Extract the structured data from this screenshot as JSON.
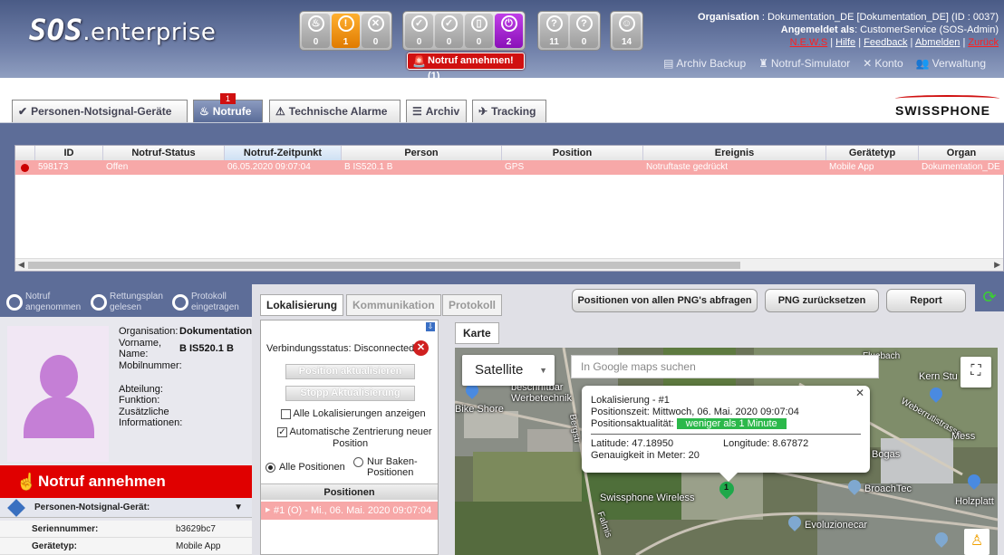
{
  "header": {
    "logo_sos": "SOS",
    "logo_rest": ".enterprise",
    "status_groups": [
      [
        {
          "count": "0",
          "color": "gray",
          "icon": "siren-icon",
          "glyph": "♨"
        },
        {
          "count": "1",
          "color": "orange",
          "icon": "exclamation-icon",
          "glyph": "!"
        },
        {
          "count": "0",
          "color": "gray",
          "icon": "x-circle-icon",
          "glyph": "✕"
        }
      ],
      [
        {
          "count": "0",
          "color": "gray",
          "icon": "check-circle-icon",
          "glyph": "✓"
        },
        {
          "count": "0",
          "color": "gray",
          "icon": "check-slash-icon",
          "glyph": "✓"
        },
        {
          "count": "0",
          "color": "gray",
          "icon": "battery-icon",
          "glyph": "▯"
        },
        {
          "count": "2",
          "color": "purple",
          "icon": "power-icon",
          "glyph": "⏻"
        }
      ],
      [
        {
          "count": "11",
          "color": "gray",
          "icon": "question-circle-icon",
          "glyph": "?"
        },
        {
          "count": "0",
          "color": "gray",
          "icon": "question-slash-icon",
          "glyph": "?"
        }
      ],
      [
        {
          "count": "14",
          "color": "gray",
          "icon": "smiley-icon",
          "glyph": "☺"
        }
      ]
    ],
    "alert_button": "Notruf annehmen! (1)",
    "org_label": "Organisation",
    "org_value": ": Dokumentation_DE [Dokumentation_DE] (ID : 0037)",
    "login_label": "Angemeldet als",
    "login_value": ": CustomerService (SOS-Admin)",
    "links": [
      "N.E.W.S",
      "Hilfe",
      "Feedback",
      "Abmelden",
      "Zurück"
    ],
    "toolbar": [
      "Archiv Backup",
      "Notruf-Simulator",
      "Konto",
      "Verwaltung"
    ]
  },
  "tabs": [
    {
      "label": "Personen-Notsignal-Geräte"
    },
    {
      "label": "Notrufe",
      "badge": "1"
    },
    {
      "label": "Technische Alarme"
    },
    {
      "label": "Archiv"
    },
    {
      "label": "Tracking"
    }
  ],
  "brand": "SWISSPHONE",
  "table": {
    "columns": [
      "ID",
      "Notruf-Status",
      "Notruf-Zeitpunkt",
      "Person",
      "Position",
      "Ereignis",
      "Gerätetyp",
      "Organ"
    ],
    "row": [
      "598173",
      "Offen",
      "06.05.2020 09:07:04",
      "B IS520.1 B",
      "GPS",
      "Notruftaste gedrückt",
      "Mobile App",
      "Dokumentation_DE"
    ]
  },
  "status_steps": [
    {
      "line1": "Notruf",
      "line2": "angenommen"
    },
    {
      "line1": "Rettungsplan",
      "line2": "gelesen"
    },
    {
      "line1": "Protokoll",
      "line2": "eingetragen"
    }
  ],
  "person": {
    "org_label": "Organisation:",
    "org_value": "Dokumentation_",
    "vorname_label": "Vorname,",
    "name_label": "Name:",
    "name_value": "B IS520.1 B",
    "mobil_label": "Mobilnummer:",
    "abteilung_label": "Abteilung:",
    "funktion_label": "Funktion:",
    "zusatz_label1": "Zusätzliche",
    "zusatz_label2": "Informationen:"
  },
  "accept_button": "Notruf annehmen",
  "device": {
    "header": "Personen-Notsignal-Gerät:",
    "serial_label": "Seriennummer:",
    "serial_value": "b3629bc7",
    "type_label": "Gerätetyp:",
    "type_value": "Mobile App"
  },
  "subtabs": [
    "Lokalisierung",
    "Kommunikation",
    "Protokoll"
  ],
  "actions": [
    "Positionen von allen PNG's abfragen",
    "PNG zurücksetzen",
    "Report"
  ],
  "localization": {
    "connection_label": "Verbindungsstatus:",
    "connection_value": "Disconnected",
    "btn_update": "Position aktualisieren",
    "btn_stop": "Stopp Aktualisierung",
    "chk_all_loc": "Alle Lokalisierungen anzeigen",
    "chk_auto_center_1": "Automatische Zentrierung neuer",
    "chk_auto_center_2": "Position",
    "radio_all": "Alle Positionen",
    "radio_beacon_1": "Nur Baken-",
    "radio_beacon_2": "Positionen",
    "positions_header": "Positionen",
    "position_row": "#1 (O) - Mi., 06. Mai. 2020 09:07:04"
  },
  "map": {
    "tab": "Karte",
    "type_select": "Satellite",
    "search_placeholder": "In Google maps suchen",
    "labels": [
      "beschriftbar",
      "Werbetechnik",
      "Bike Shore",
      "Swissphone Wireless",
      "Kern Stu",
      "Weberrutistrasse",
      "BroachTec",
      "Holzplatt",
      "Evoluzionecar",
      "Bergstr",
      "Falmis",
      "Fluebach",
      "Bogas",
      "Mess"
    ],
    "popup": {
      "title": "Lokalisierung - #1",
      "time": "Positionszeit: Mittwoch, 06. Mai. 2020 09:07:04",
      "actuality_label": "Positionsaktualität:",
      "actuality_value": "weniger als 1 Minute",
      "lat": "Latitude: 47.18950",
      "lon": "Longitude: 8.67872",
      "accuracy": "Genauigkeit in Meter: 20"
    },
    "marker": "1"
  }
}
